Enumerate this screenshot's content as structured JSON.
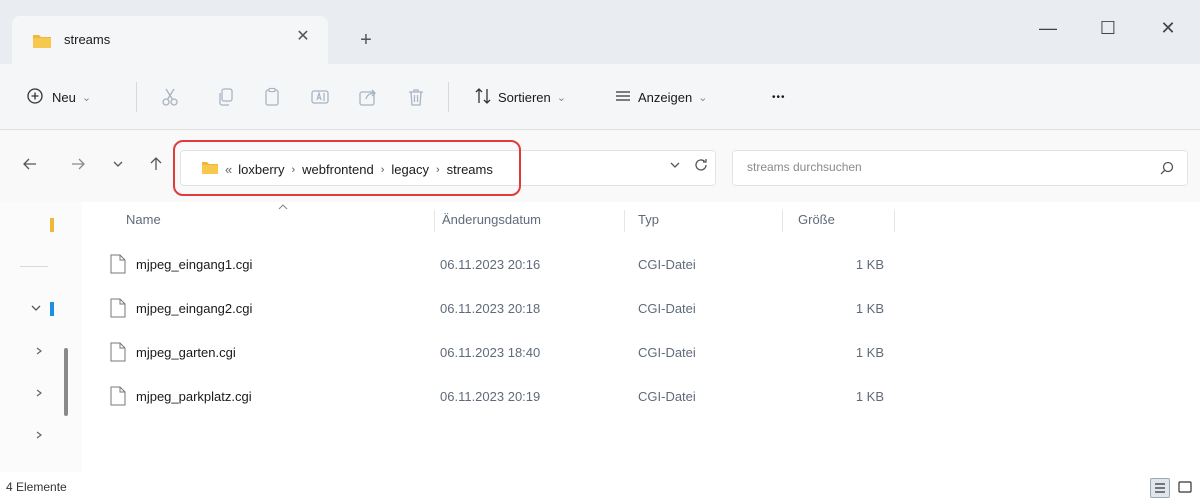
{
  "tab": {
    "title": "streams",
    "close_glyph": "✕",
    "new_glyph": "+"
  },
  "window": {
    "minimize": "—",
    "maximize": "☐",
    "close": "✕"
  },
  "toolbar": {
    "new_label": "Neu",
    "sort_label": "Sortieren",
    "view_label": "Anzeigen",
    "more_glyph": "•••",
    "chevron": "⌄"
  },
  "address": {
    "crumbs": [
      "«",
      "loxberry",
      "webfrontend",
      "legacy",
      "streams"
    ],
    "separator": "›"
  },
  "search": {
    "placeholder": "streams durchsuchen"
  },
  "columns": {
    "name": "Name",
    "date": "Änderungsdatum",
    "type": "Typ",
    "size": "Größe"
  },
  "files": [
    {
      "name": "mjpeg_eingang1.cgi",
      "date": "06.11.2023 20:16",
      "type": "CGI-Datei",
      "size": "1 KB"
    },
    {
      "name": "mjpeg_eingang2.cgi",
      "date": "06.11.2023 20:18",
      "type": "CGI-Datei",
      "size": "1 KB"
    },
    {
      "name": "mjpeg_garten.cgi",
      "date": "06.11.2023 18:40",
      "type": "CGI-Datei",
      "size": "1 KB"
    },
    {
      "name": "mjpeg_parkplatz.cgi",
      "date": "06.11.2023 20:19",
      "type": "CGI-Datei",
      "size": "1 KB"
    }
  ],
  "status": {
    "count_text": "4 Elemente"
  },
  "colors": {
    "folder": "#f0b83a",
    "highlight": "#e03a3a",
    "accent": "#1d8fe0"
  },
  "icons": [
    "folder-icon",
    "cut-icon",
    "copy-icon",
    "paste-icon",
    "rename-icon",
    "share-icon",
    "delete-icon",
    "search-icon",
    "file-icon"
  ]
}
